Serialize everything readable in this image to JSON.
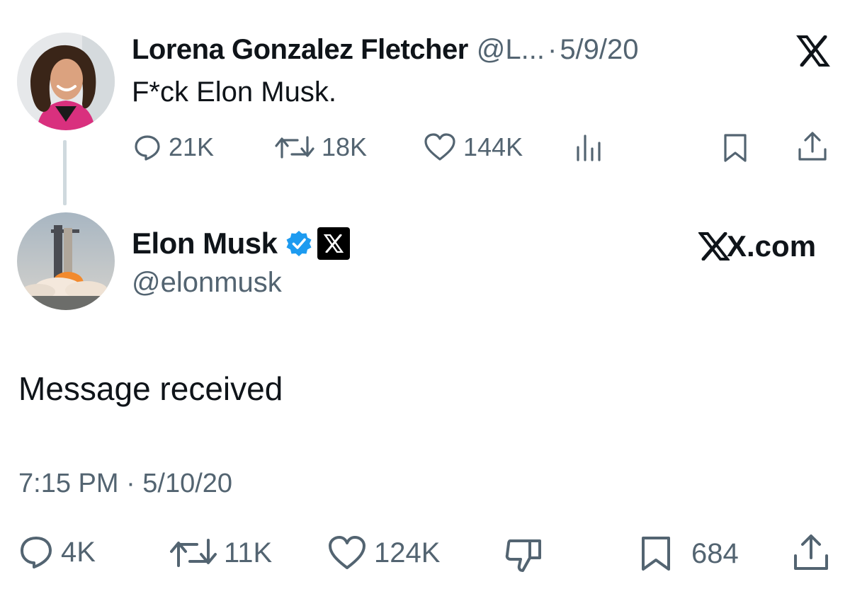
{
  "parent_tweet": {
    "author_name": "Lorena Gonzalez Fletcher",
    "handle_truncated": "@L...",
    "separator": "·",
    "date": "5/9/20",
    "text": "F*ck Elon Musk.",
    "actions": {
      "replies": "21K",
      "retweets": "18K",
      "likes": "144K"
    }
  },
  "reply_tweet": {
    "author_name": "Elon Musk",
    "handle": "@elonmusk",
    "site_label": "X.com",
    "text": "Message received",
    "timestamp": "7:15 PM · 5/10/20",
    "actions": {
      "replies": "4K",
      "retweets": "11K",
      "likes": "124K",
      "bookmarks": "684"
    }
  },
  "colors": {
    "text": "#0f1419",
    "secondary": "#536471",
    "verified": "#1d9bf0",
    "thread_line": "#cfd9de"
  }
}
